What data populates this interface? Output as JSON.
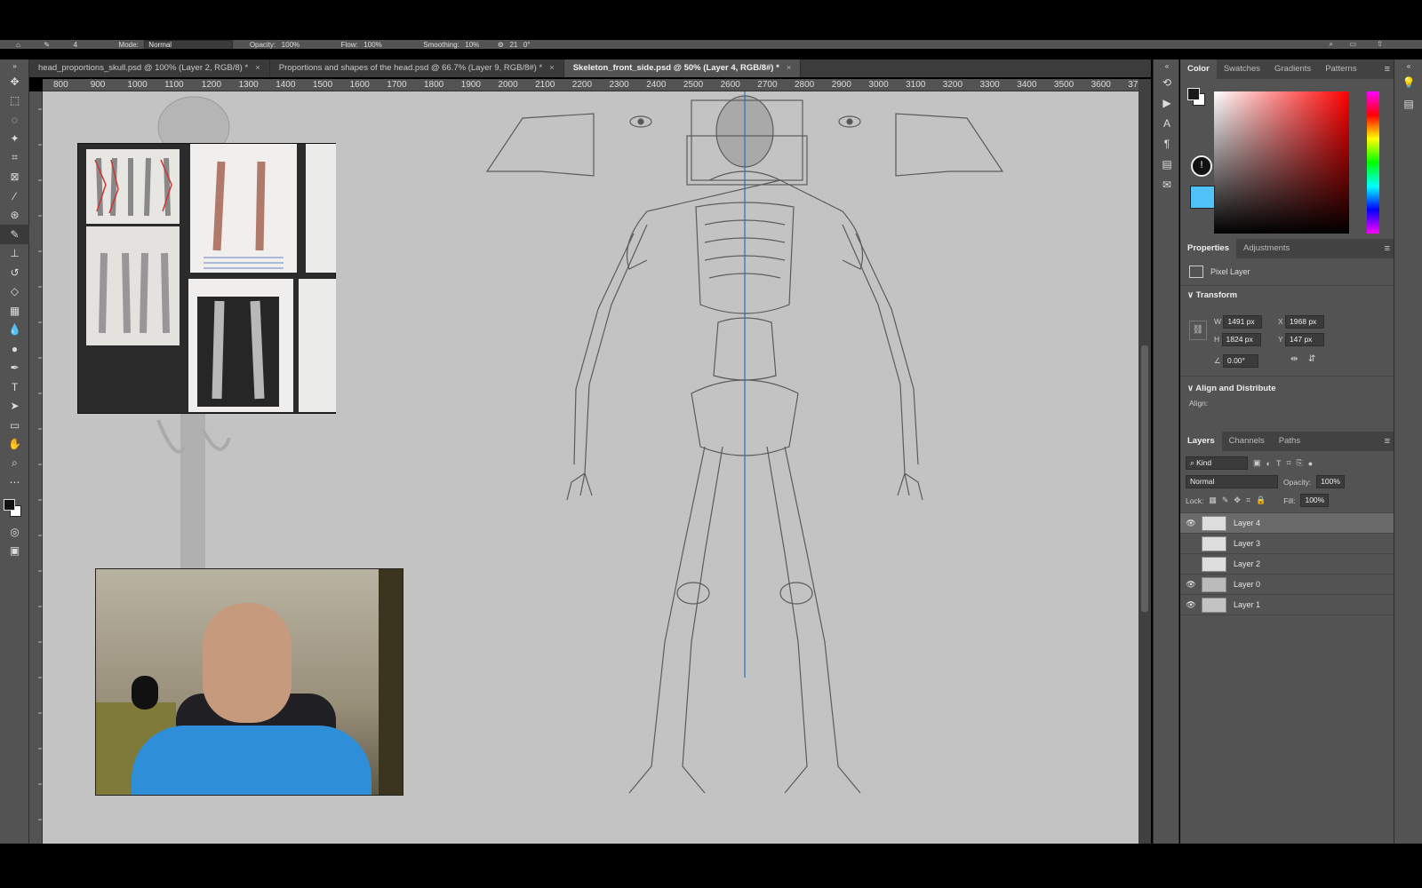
{
  "options_bar": {
    "brush_size": "4",
    "mode_label": "Mode:",
    "mode_value": "Normal",
    "opacity_label": "Opacity:",
    "opacity_value": "100%",
    "flow_label": "Flow:",
    "flow_value": "100%",
    "smoothing_label": "Smoothing:",
    "smoothing_value": "10%",
    "angle_value": "21",
    "angle_unit": "0°"
  },
  "tabs": [
    {
      "label": "head_proportions_skull.psd @ 100% (Layer 2, RGB/8) *"
    },
    {
      "label": "Proportions and shapes of the head.psd @ 66.7% (Layer 9, RGB/8#) *"
    },
    {
      "label": "Skeleton_front_side.psd @ 50% (Layer 4, RGB/8#) *"
    }
  ],
  "ruler_ticks": [
    "800",
    "900",
    "1000",
    "1100",
    "1200",
    "1300",
    "1400",
    "1500",
    "1600",
    "1700",
    "1800",
    "1900",
    "2000",
    "2100",
    "2200",
    "2300",
    "2400",
    "2500",
    "2600",
    "2700",
    "2800",
    "2900",
    "3000",
    "3100",
    "3200",
    "3300",
    "3400",
    "3500",
    "3600",
    "37"
  ],
  "color_panel": {
    "tabs": [
      "Color",
      "Swatches",
      "Gradients",
      "Patterns"
    ],
    "foreground": "#1a1a1a",
    "background": "#ffffff",
    "picker_hue": "#ff0000",
    "warning_color": "#4fc3f7"
  },
  "properties": {
    "tabs": [
      "Properties",
      "Adjustments"
    ],
    "layer_type": "Pixel Layer",
    "transform_title": "Transform",
    "w_label": "W",
    "w": "1491 px",
    "h_label": "H",
    "h": "1824 px",
    "x_label": "X",
    "x": "1968 px",
    "y_label": "Y",
    "y": "147 px",
    "angle": "0.00°",
    "align_title": "Align and Distribute",
    "align_label": "Align:"
  },
  "layers_panel": {
    "tabs": [
      "Layers",
      "Channels",
      "Paths"
    ],
    "filter": "Kind",
    "blend_mode": "Normal",
    "opacity_label": "Opacity:",
    "opacity": "100%",
    "lock_label": "Lock:",
    "fill_label": "Fill:",
    "fill": "100%",
    "layers": [
      {
        "name": "Layer 4",
        "visible": true,
        "selected": true
      },
      {
        "name": "Layer 3",
        "visible": false,
        "selected": false
      },
      {
        "name": "Layer 2",
        "visible": false,
        "selected": false
      },
      {
        "name": "Layer 0",
        "visible": true,
        "selected": false
      },
      {
        "name": "Layer 1",
        "visible": true,
        "selected": false
      }
    ]
  }
}
